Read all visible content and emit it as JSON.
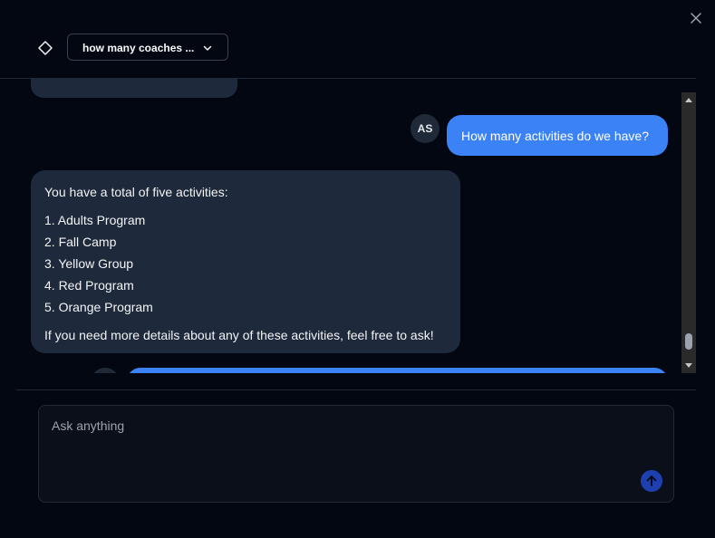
{
  "window": {
    "close_icon": "close-icon"
  },
  "header": {
    "logo_icon": "diamond-icon",
    "conversation_select": {
      "selected": "how many coaches ...",
      "icon": "chevron-down-icon"
    }
  },
  "messages": [
    {
      "role": "user",
      "avatar": "AS",
      "text": "How many activities do we have?"
    },
    {
      "role": "assistant",
      "intro": "You have a total of five activities:",
      "items": [
        "1. Adults Program",
        "2. Fall Camp",
        "3. Yellow Group",
        "4. Red Program",
        "5. Orange Program"
      ],
      "outro": "If you need more details about any of these activities, feel free to ask!"
    }
  ],
  "composer": {
    "placeholder": "Ask anything",
    "value": "",
    "send_icon": "arrow-up-icon"
  },
  "colors": {
    "background": "#030712",
    "user_bubble": "#3b82f6",
    "assistant_bubble": "#1e293b",
    "send_button": "#1e40af"
  }
}
